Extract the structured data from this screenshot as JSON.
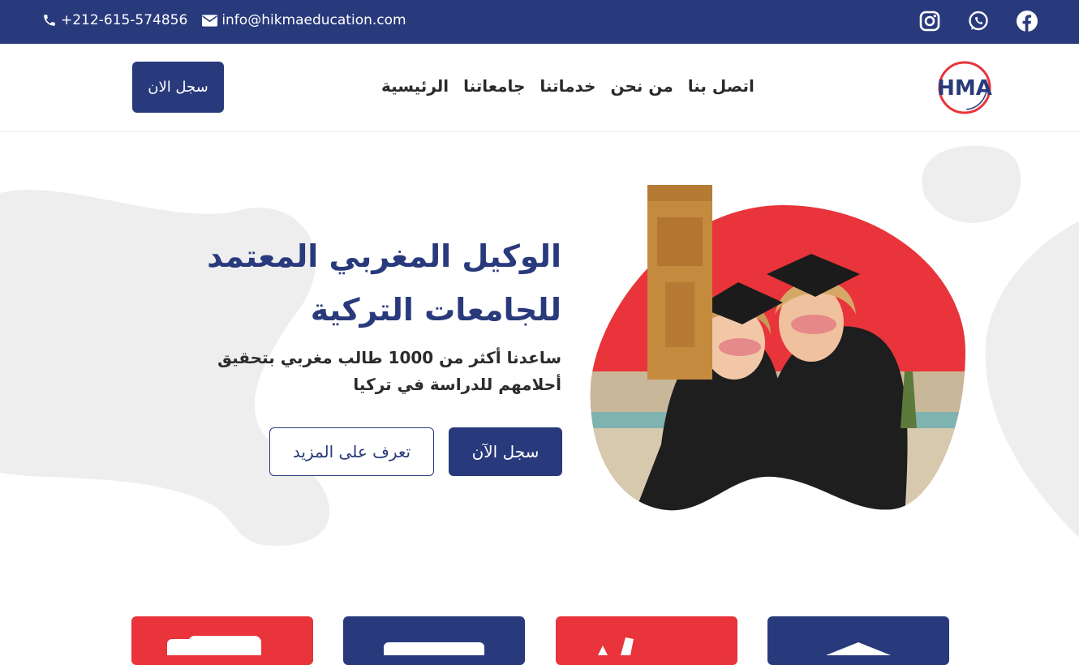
{
  "topbar": {
    "phone": "+212-615-574856",
    "email": "info@hikmaeducation.com",
    "social_icons": [
      "instagram-icon",
      "whatsapp-icon",
      "facebook-icon"
    ]
  },
  "nav": {
    "cta_label": "سجل الان",
    "links": [
      "الرئيسية",
      "جامعاتنا",
      "خدماتنا",
      "من نحن",
      "اتصل بنا"
    ],
    "logo_text": "HMA"
  },
  "hero": {
    "title": "الوكيل المغربي المعتمد للجامعات التركية",
    "subtitle": "ساعدنا أكثر من 1000 طالب مغربي بتحقيق أحلامهم للدراسة في تركيا",
    "primary_button": "سجل الآن",
    "secondary_button": "تعرف على المزيد"
  },
  "colors": {
    "brand_blue": "#293a7c",
    "brand_red": "#e8343a",
    "blob_gray": "#eeeeef"
  },
  "cards": [
    {
      "color": "#e8343a",
      "icon": "scroll-icon"
    },
    {
      "color": "#293a7c",
      "icon": "document-icon"
    },
    {
      "color": "#e8343a",
      "icon": "plane-icon"
    },
    {
      "color": "#293a7c",
      "icon": "university-icon"
    }
  ]
}
